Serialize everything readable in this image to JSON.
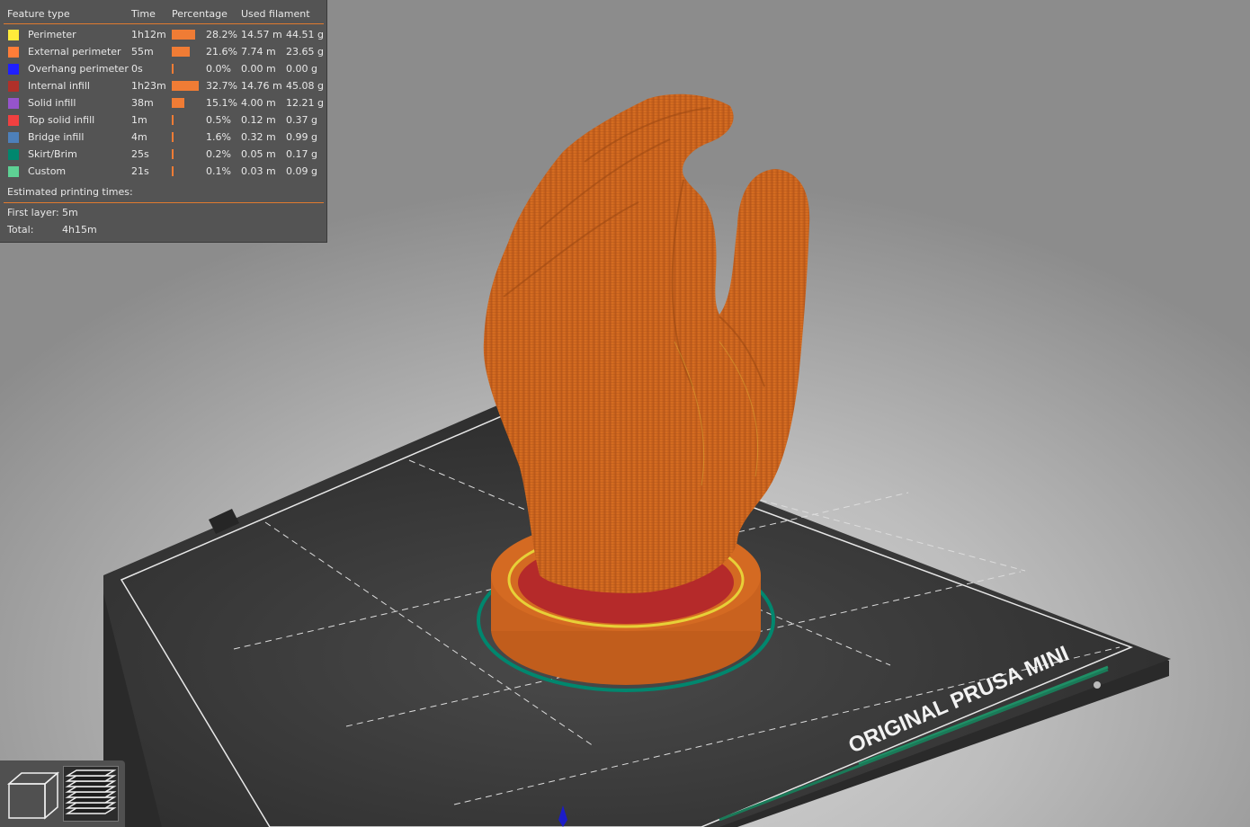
{
  "legend": {
    "headers": {
      "feature": "Feature type",
      "time": "Time",
      "percentage": "Percentage",
      "filament": "Used filament"
    },
    "rows": [
      {
        "name": "Perimeter",
        "time": "1h12m",
        "pct": "28.2%",
        "length": "14.57 m",
        "weight": "44.51 g",
        "color": "#ffeb3b",
        "share": 0.282
      },
      {
        "name": "External perimeter",
        "time": "55m",
        "pct": "21.6%",
        "length": "7.74 m",
        "weight": "23.65 g",
        "color": "#ff7d38",
        "share": 0.216
      },
      {
        "name": "Overhang perimeter",
        "time": "0s",
        "pct": "0.0%",
        "length": "0.00 m",
        "weight": "0.00 g",
        "color": "#1f1fff",
        "share": 0.0
      },
      {
        "name": "Internal infill",
        "time": "1h23m",
        "pct": "32.7%",
        "length": "14.76 m",
        "weight": "45.08 g",
        "color": "#b03029",
        "share": 0.327
      },
      {
        "name": "Solid infill",
        "time": "38m",
        "pct": "15.1%",
        "length": "4.00 m",
        "weight": "12.21 g",
        "color": "#9654cc",
        "share": 0.151
      },
      {
        "name": "Top solid infill",
        "time": "1m",
        "pct": "0.5%",
        "length": "0.12 m",
        "weight": "0.37 g",
        "color": "#f04040",
        "share": 0.005
      },
      {
        "name": "Bridge infill",
        "time": "4m",
        "pct": "1.6%",
        "length": "0.32 m",
        "weight": "0.99 g",
        "color": "#4d80ba",
        "share": 0.016
      },
      {
        "name": "Skirt/Brim",
        "time": "25s",
        "pct": "0.2%",
        "length": "0.05 m",
        "weight": "0.17 g",
        "color": "#00876e",
        "share": 0.002
      },
      {
        "name": "Custom",
        "time": "21s",
        "pct": "0.1%",
        "length": "0.03 m",
        "weight": "0.09 g",
        "color": "#5ed194",
        "share": 0.001
      }
    ],
    "estimated_label": "Estimated printing times:",
    "first_layer_label": "First layer:",
    "first_layer_value": "5m",
    "total_label": "Total:",
    "total_value": "4h15m"
  },
  "bed": {
    "label": "ORIGINAL PRUSA MINI"
  },
  "view_buttons": [
    {
      "icon": "3d-view-icon",
      "active": false
    },
    {
      "icon": "gcode-preview-icon",
      "active": true
    }
  ],
  "colors": {
    "model": "#d4691e",
    "bed": "#3b3b3b",
    "accent": "#f07c35"
  }
}
